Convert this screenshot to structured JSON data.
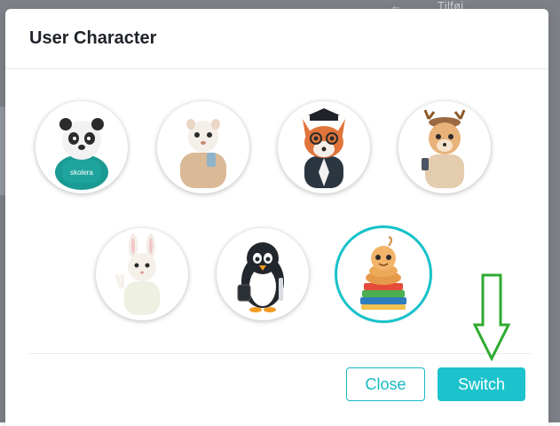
{
  "background": {
    "hint_text": "Tilføj"
  },
  "dialog": {
    "title": "User Character",
    "characters": [
      {
        "name": "panda",
        "selected": false,
        "hoodie_text": "skolera"
      },
      {
        "name": "ferret",
        "selected": false
      },
      {
        "name": "fox",
        "selected": false
      },
      {
        "name": "deer",
        "selected": false
      },
      {
        "name": "bunny",
        "selected": false
      },
      {
        "name": "penguin",
        "selected": false
      },
      {
        "name": "bookworm",
        "selected": true
      }
    ],
    "buttons": {
      "close_label": "Close",
      "switch_label": "Switch"
    }
  },
  "colors": {
    "accent": "#1cc3cc",
    "selected_ring": "#17c2c9",
    "annotation_arrow": "#2faa2f"
  }
}
